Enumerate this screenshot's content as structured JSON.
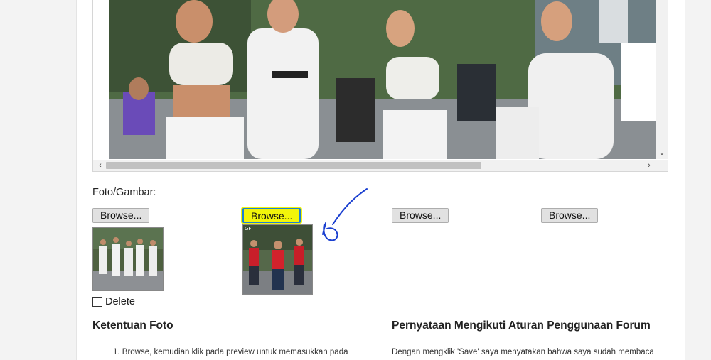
{
  "form": {
    "foto_label": "Foto/Gambar:",
    "browse_buttons": [
      "Browse...",
      "Browse...",
      "Browse...",
      "Browse..."
    ],
    "delete_label": "Delete",
    "thumb_badge": "GF"
  },
  "sections": {
    "ketentuan_title": "Ketentuan Foto",
    "ketentuan_item1": "1. Browse, kemudian klik pada preview untuk memasukkan pada",
    "pernyataan_title": "Pernyataan Mengikuti Aturan Penggunaan Forum",
    "pernyataan_text": "Dengan mengklik 'Save' saya menyatakan bahwa saya sudah membaca"
  },
  "icons": {
    "scroll_down": "chevron-down-icon",
    "scroll_left": "chevron-left-icon",
    "scroll_right": "chevron-right-icon",
    "annotation": "hand-drawn-arrow-icon"
  },
  "colors": {
    "highlight": "#f2f50a",
    "highlight_border": "#1d7fd4",
    "annotation_ink": "#1a3fd0"
  }
}
